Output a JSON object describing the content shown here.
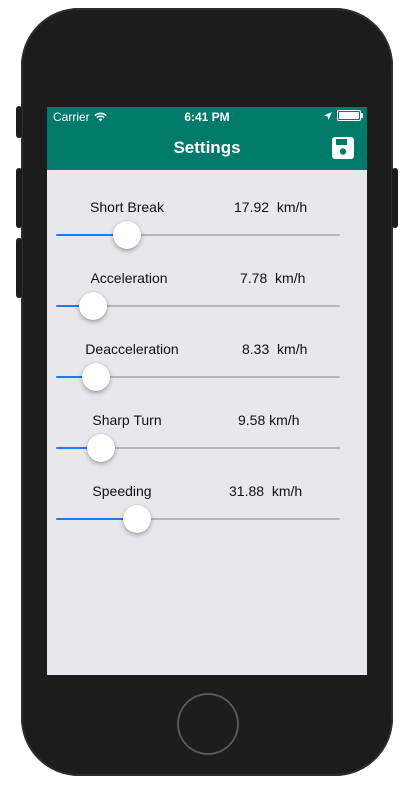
{
  "status_bar": {
    "carrier": "Carrier",
    "time": "6:41 PM"
  },
  "navbar": {
    "title": "Settings",
    "save_icon": "floppy-disk-icon"
  },
  "colors": {
    "accent": "#007a6a",
    "slider_fill": "#1a7cf5",
    "background": "#e7e7ec"
  },
  "settings": [
    {
      "label": "Short Break",
      "value": "17.92  km/h",
      "slider_fraction": 0.25
    },
    {
      "label": "Acceleration",
      "value": "7.78  km/h",
      "slider_fraction": 0.13
    },
    {
      "label": "Deacceleration",
      "value": "8.33  km/h",
      "slider_fraction": 0.14
    },
    {
      "label": "Sharp Turn",
      "value": "9.58 km/h",
      "slider_fraction": 0.16
    },
    {
      "label": "Speeding",
      "value": "31.88  km/h",
      "slider_fraction": 0.285
    }
  ]
}
